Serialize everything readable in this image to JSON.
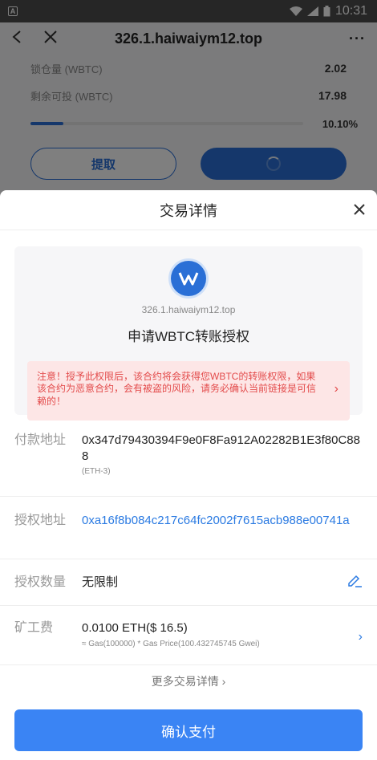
{
  "statusbar": {
    "time": "10:31",
    "left_icon": "A"
  },
  "navbar": {
    "title": "326.1.haiwaiym12.top",
    "back_icon": "arrow-left",
    "close_icon": "x",
    "more_icon": "ellipsis"
  },
  "background": {
    "rows": [
      {
        "label": "锁仓量 (WBTC)",
        "value": "2.02"
      },
      {
        "label": "剩余可投 (WBTC)",
        "value": "17.98"
      }
    ],
    "progress": {
      "percent_text": "10.10%",
      "fraction": 0.101
    },
    "withdraw_label": "提取"
  },
  "sheet": {
    "title": "交易详情",
    "close_icon": "x",
    "dapp": {
      "domain": "326.1.haiwaiym12.top",
      "request": "申请WBTC转账授权",
      "warning": "注意！授予此权限后，该合约将会获得您WBTC的转账权限，如果该合约为恶意合约，会有被盗的风险，请务必确认当前链接是可信赖的！"
    },
    "fields": {
      "pay_label": "付款地址",
      "pay_value": "0x347d79430394F9e0F8Fa912A02282B1E3f80C888",
      "pay_sub": "(ETH-3)",
      "auth_label": "授权地址",
      "auth_value": "0xa16f8b084c217c64fc2002f7615acb988e00741a",
      "amount_label": "授权数量",
      "amount_value": "无限制",
      "fee_label": "矿工费",
      "fee_value": "0.0100 ETH($ 16.5)",
      "fee_sub": "≈ Gas(100000) * Gas Price(100.432745745 Gwei)"
    },
    "more_details": "更多交易详情 ›",
    "confirm_label": "确认支付"
  },
  "colors": {
    "accent": "#3a84f4",
    "warning_bg": "#fde6e6",
    "warning_text": "#e34b4b",
    "link": "#2a7ae2"
  }
}
